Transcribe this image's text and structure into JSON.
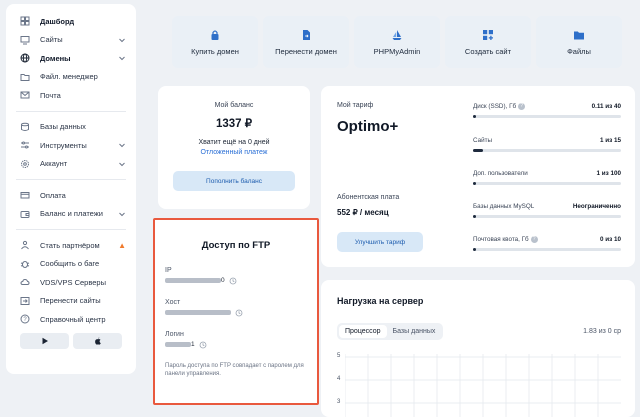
{
  "sidebar": {
    "items": [
      {
        "label": "Дашборд",
        "icon": "dashboard-icon"
      },
      {
        "label": "Сайты",
        "icon": "monitor-icon"
      },
      {
        "label": "Домены",
        "icon": "globe-icon"
      },
      {
        "label": "Файл. менеджер",
        "icon": "folder-icon"
      },
      {
        "label": "Почта",
        "icon": "mail-icon"
      },
      {
        "label": "Базы данных",
        "icon": "database-icon"
      },
      {
        "label": "Инструменты",
        "icon": "sliders-icon"
      },
      {
        "label": "Аккаунт",
        "icon": "gear-icon"
      },
      {
        "label": "Оплата",
        "icon": "card-icon"
      },
      {
        "label": "Баланс и платежи",
        "icon": "wallet-icon"
      },
      {
        "label": "Стать партнёром",
        "icon": "partner-icon"
      },
      {
        "label": "Сообщить о баге",
        "icon": "bug-icon"
      },
      {
        "label": "VDS/VPS Серверы",
        "icon": "cloud-icon"
      },
      {
        "label": "Перенести сайты",
        "icon": "transfer-icon"
      },
      {
        "label": "Справочный центр",
        "icon": "help-icon"
      }
    ]
  },
  "quick_actions": [
    {
      "label": "Купить домен",
      "icon": "lock-bag-icon"
    },
    {
      "label": "Перенести домен",
      "icon": "document-icon"
    },
    {
      "label": "PHPMyAdmin",
      "icon": "sailboat-icon"
    },
    {
      "label": "Создать сайт",
      "icon": "grid-plus-icon"
    },
    {
      "label": "Файлы",
      "icon": "folder-icon"
    }
  ],
  "balance": {
    "title": "Мой баланс",
    "amount": "1337 ₽",
    "days": "Хватит ещё на 0 дней",
    "deferred": "Отложенный платеж",
    "topup": "Пополнить баланс"
  },
  "tariff": {
    "title": "Мой тариф",
    "name": "Optimo+",
    "fee_label": "Абонентская плата",
    "fee": "552 ₽ / месяц",
    "upgrade": "Улучшить тариф",
    "stats": [
      {
        "label": "Диск (SSD), Гб",
        "value": "0.11 из 40",
        "info": true,
        "usage": 0.003
      },
      {
        "label": "Сайты",
        "value": "1 из 15",
        "info": false,
        "usage": 0.067
      },
      {
        "label": "Доп. пользователи",
        "value": "1 из 100",
        "info": false,
        "usage": 0.01
      },
      {
        "label": "Базы данных MySQL",
        "value": "Неограниченно",
        "info": false,
        "usage": 0
      },
      {
        "label": "Почтовая квота, Гб",
        "value": "0 из 10",
        "info": true,
        "usage": 0
      }
    ]
  },
  "ftp": {
    "title": "Доступ по FTP",
    "ip_label": "IP",
    "ip_tail": "0",
    "host_label": "Хост",
    "login_label": "Логин",
    "login_tail": "1",
    "note": "Пароль доступа по FTP совпадает с паролем для панели управления."
  },
  "load": {
    "title": "Нагрузка на сервер",
    "tabs": [
      "Процессор",
      "Базы данных"
    ],
    "summary": "1.83 из 0 ср",
    "y_ticks": [
      "5",
      "4",
      "3"
    ]
  },
  "colors": {
    "accent": "#1d5cae",
    "highlight_border": "#e9593e",
    "page_bg": "#eef1f5"
  }
}
